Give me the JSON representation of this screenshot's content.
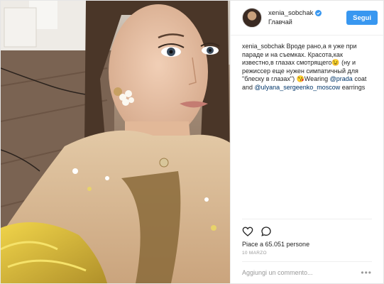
{
  "post": {
    "author": {
      "username": "xenia_sobchak",
      "location": "Главчай"
    },
    "follow_label": "Segui",
    "caption": {
      "username": "xenia_sobchak",
      "part1": " Вроде рано,а я уже при параде и на съемках. Красота,как известно,в глазах смотрящего😉 (ну и режиссер еще нужен симпатичный для \"блеску в глазах\") 😘Wearing ",
      "link1": "@prada",
      "part2": " coat and ",
      "link2": "@ulyana_sergeenko_moscow",
      "part3": " earrings"
    },
    "likes_text": "Piace a 65.051 persone",
    "date": "10 MARZO",
    "comment_placeholder": "Aggiungi un commento...",
    "more_label": "•••"
  },
  "colors": {
    "accent": "#3897f0",
    "link": "#003569",
    "muted": "#999999"
  },
  "icons": {
    "verified": "verified-badge-icon",
    "like": "heart-icon",
    "comment": "comment-bubble-icon",
    "more": "more-options-icon"
  }
}
